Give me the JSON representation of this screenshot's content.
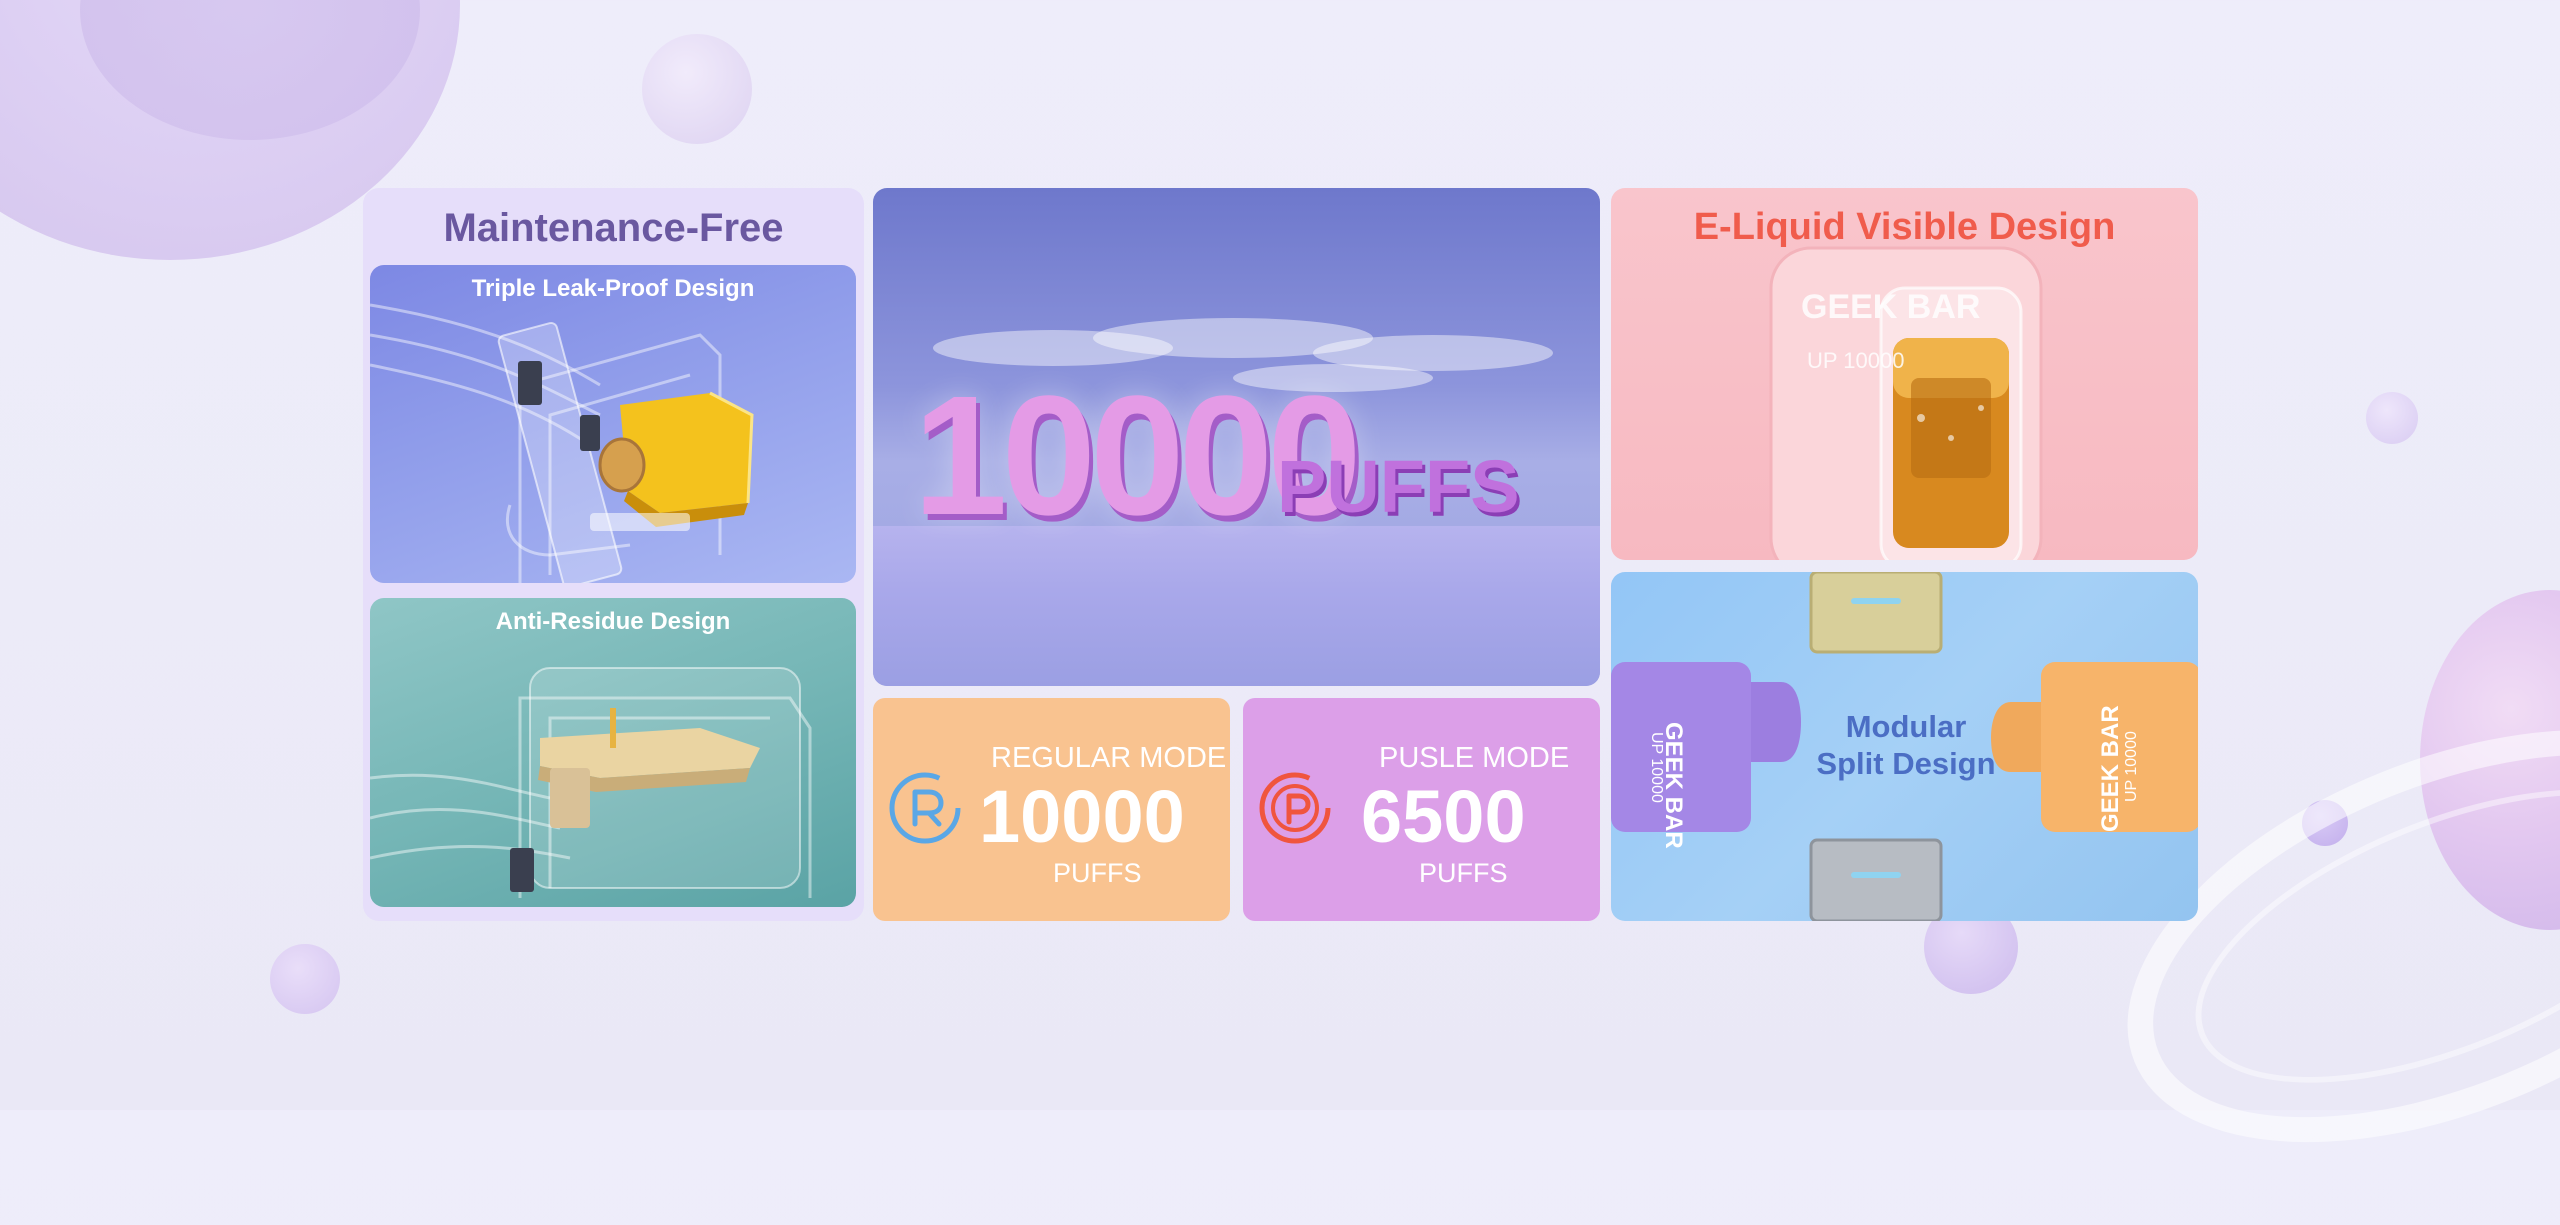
{
  "left_panel": {
    "title": "Maintenance-Free",
    "card1_caption": "Triple Leak-Proof Design",
    "card2_caption": "Anti-Residue Design"
  },
  "hero": {
    "number": "10000",
    "unit": "PUFFS"
  },
  "regular_mode": {
    "label": "REGULAR MODE",
    "value": "10000",
    "unit": "PUFFS",
    "icon": "regular-mode-icon"
  },
  "pulse_mode": {
    "label": "PUSLE MODE",
    "value": "6500",
    "unit": "PUFFS",
    "icon": "pulse-mode-icon"
  },
  "eliquid": {
    "title": "E-Liquid Visible Design",
    "device_brand": "GEEK BAR",
    "device_model": "UP 10000"
  },
  "modular": {
    "line1": "Modular",
    "line2": "Split Design",
    "device_brand": "GEEK BAR",
    "device_model": "UP 10000"
  },
  "colors": {
    "left_title": "#6a58a0",
    "eliquid_title": "#f05c4c",
    "modular_title": "#4b6ec4",
    "regular_bg": "#f9c390",
    "pulse_bg": "#dc9fe8",
    "regular_icon": "#5aa7e6",
    "pulse_icon": "#f0553e"
  }
}
